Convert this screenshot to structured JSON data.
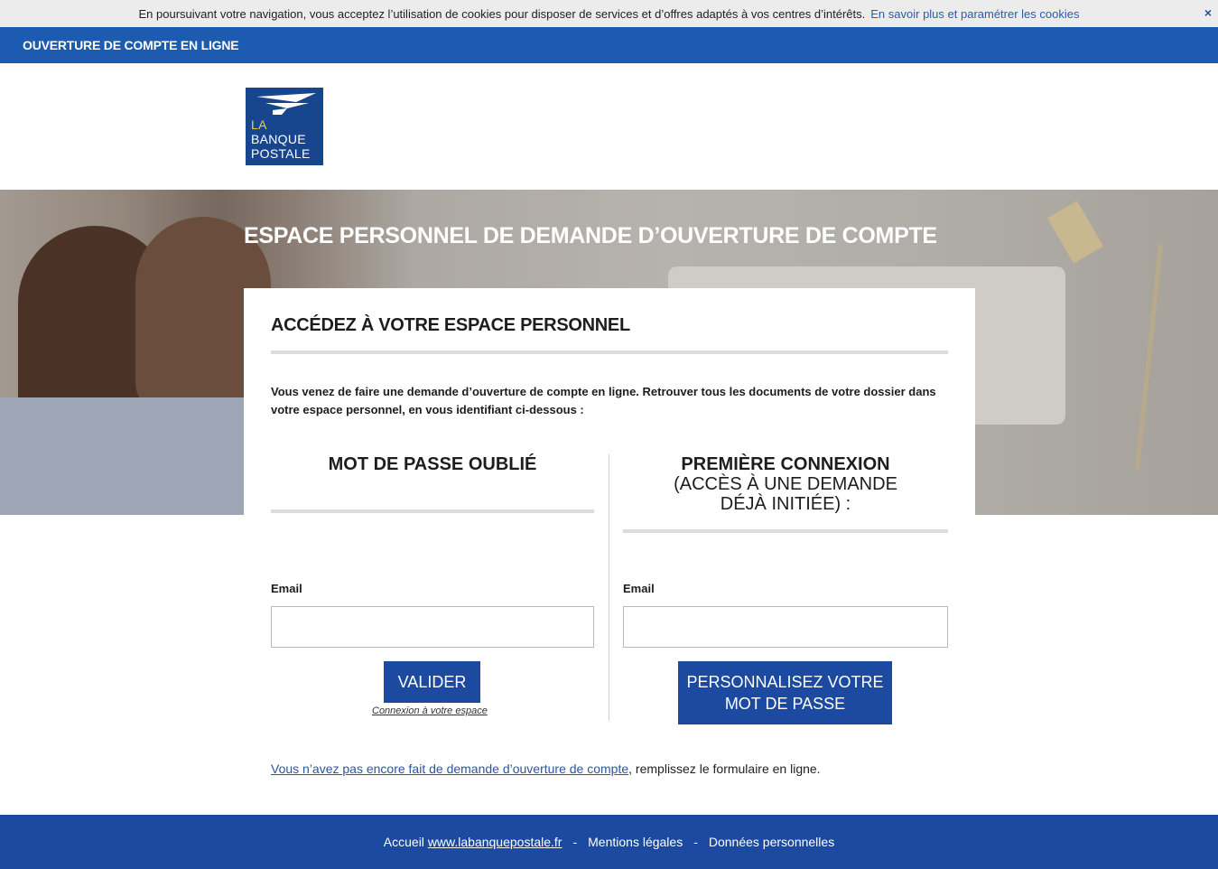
{
  "cookie": {
    "text": "En poursuivant votre navigation, vous acceptez l’utilisation de cookies pour disposer de services et d’offres adaptés à vos centres d’intérêts.",
    "link": "En savoir plus et paramétrer les cookies",
    "close": "×"
  },
  "topbar": {
    "title": "OUVERTURE DE COMPTE EN LIGNE"
  },
  "logo": {
    "line1": "LA",
    "line2": "BANQUE",
    "line3": "POSTALE"
  },
  "hero": {
    "title": "ESPACE PERSONNEL DE DEMANDE D’OUVERTURE DE COMPTE"
  },
  "card": {
    "title": "ACCÉDEZ À VOTRE ESPACE PERSONNEL",
    "intro": "Vous venez de faire une demande d’ouverture de compte en ligne. Retrouver tous les documents de votre dossier dans votre espace personnel, en vous identifiant ci-dessous :",
    "left": {
      "title": "MOT DE PASSE OUBLIÉ",
      "email_label": "Email",
      "email_value": "",
      "button": "VALIDER",
      "link": "Connexion à votre espace"
    },
    "right": {
      "title": "PREMIÈRE CONNEXION",
      "subtitle_1": "(ACCÈS À UNE DEMANDE",
      "subtitle_2": "DÉJÀ INITIÉE) :",
      "email_label": "Email",
      "email_value": "",
      "button_line1": "PERSONNALISEZ VOTRE",
      "button_line2": "MOT DE PASSE"
    },
    "bottom_link": "Vous n’avez pas encore fait de demande d’ouverture de compte",
    "bottom_text": ", remplissez le formulaire en ligne."
  },
  "footer": {
    "accueil": "Accueil",
    "site": "www.labanquepostale.fr",
    "sep": "-",
    "mentions": "Mentions légales",
    "donnees": "Données personnelles"
  },
  "colors": {
    "primary_blue": "#1b4aa0",
    "topbar_blue": "#1c5bb0",
    "logo_yellow": "#f3cc2c"
  }
}
